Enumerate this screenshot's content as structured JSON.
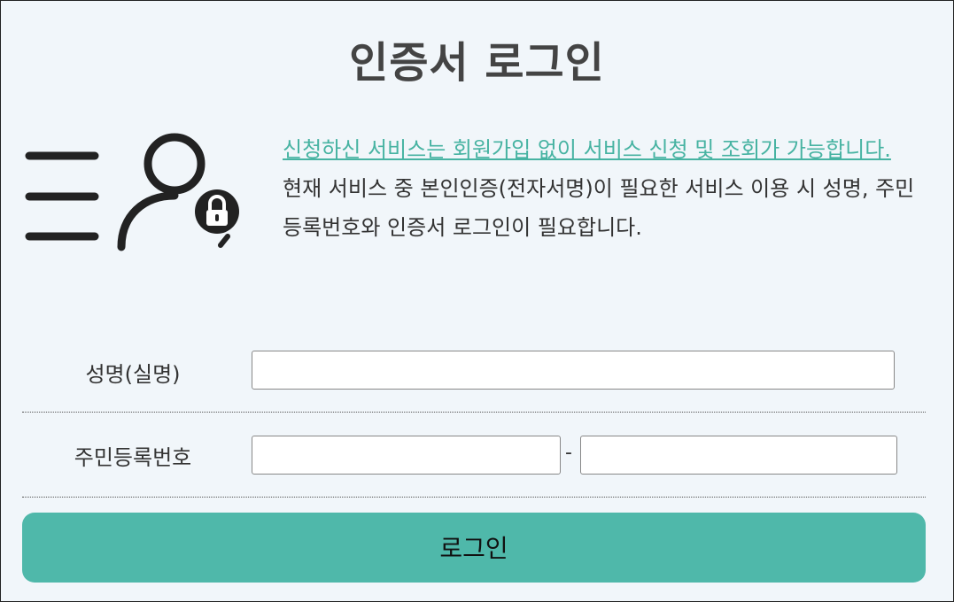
{
  "title": "인증서 로그인",
  "info": {
    "notice": "신청하신 서비스는 회원가입 없이 서비스 신청 및 조회가 가능합니다.",
    "desc": "현재 서비스 중 본인인증(전자서명)이 필요한 서비스 이용 시 성명, 주민등록번호와 인증서 로그인이 필요합니다."
  },
  "form": {
    "name_label": "성명(실명)",
    "rrn_label": "주민등록번호",
    "rrn_separator": "-"
  },
  "login_button": "로그인",
  "colors": {
    "accent": "#4fb8aa",
    "notice_text": "#47b3a2",
    "background": "#f1f6fa"
  },
  "icons": [
    "menu-icon",
    "user-lock-icon"
  ]
}
